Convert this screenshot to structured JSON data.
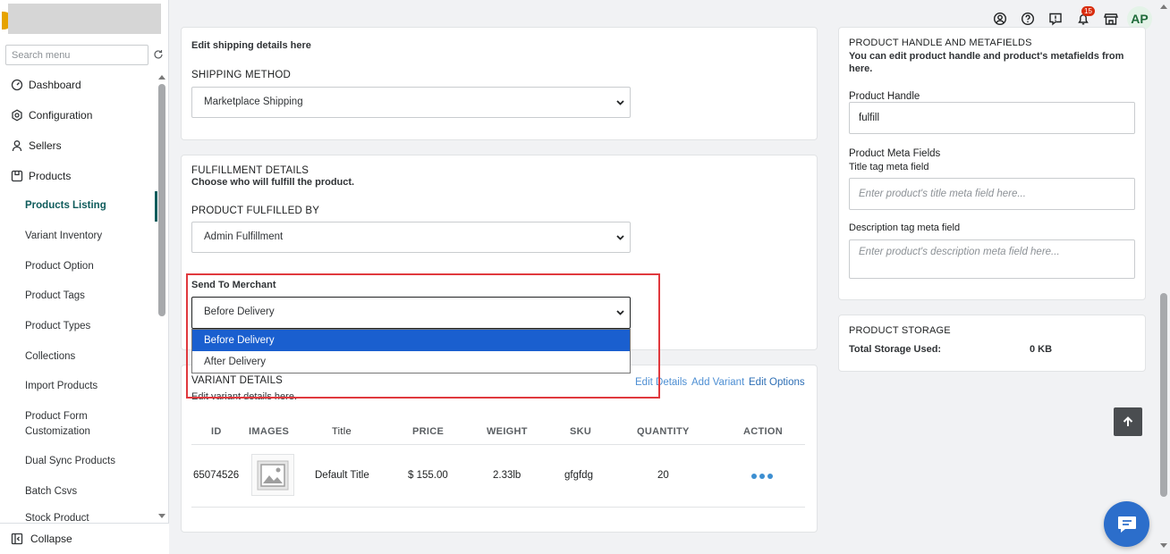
{
  "sidebar": {
    "search_placeholder": "Search menu",
    "top_items": [
      {
        "label": "Dashboard",
        "icon": "dashboard-icon"
      },
      {
        "label": "Configuration",
        "icon": "gear-icon"
      },
      {
        "label": "Sellers",
        "icon": "user-icon"
      },
      {
        "label": "Products",
        "icon": "product-icon"
      }
    ],
    "sub_items": [
      {
        "label": "Products Listing",
        "active": true
      },
      {
        "label": "Variant Inventory"
      },
      {
        "label": "Product Option"
      },
      {
        "label": "Product Tags"
      },
      {
        "label": "Product Types"
      },
      {
        "label": "Collections"
      },
      {
        "label": "Import Products"
      },
      {
        "label": "Product Form Customization"
      },
      {
        "label": "Dual Sync Products"
      },
      {
        "label": "Batch Csvs"
      },
      {
        "label": "Stock Product"
      }
    ],
    "collapse_label": "Collapse"
  },
  "topbar": {
    "notification_count": "15",
    "avatar_initials": "AP"
  },
  "shipping": {
    "subtitle": "Edit shipping details here",
    "method_label": "SHIPPING METHOD",
    "method_value": "Marketplace Shipping"
  },
  "fulfillment": {
    "title": "FULFILLMENT DETAILS",
    "subtitle": "Choose who will fulfill the product.",
    "by_label": "PRODUCT FULFILLED BY",
    "by_value": "Admin Fulfillment",
    "send_label": "Send To Merchant",
    "send_value": "Before Delivery",
    "send_options": [
      "Before Delivery",
      "After Delivery"
    ]
  },
  "variants": {
    "title": "VARIANT DETAILS",
    "subtitle": "Edit variant details here.",
    "edit_details": "Edit Details",
    "add_variant": "Add Variant",
    "edit_options": "Edit Options",
    "columns": [
      "ID",
      "IMAGES",
      "Title",
      "PRICE",
      "WEIGHT",
      "SKU",
      "QUANTITY",
      "ACTION"
    ],
    "row": {
      "id": "65074526",
      "title": "Default Title",
      "price": "$ 155.00",
      "weight": "2.33lb",
      "sku": "gfgfdg",
      "quantity": "20"
    }
  },
  "handle": {
    "title": "PRODUCT HANDLE AND METAFIELDS",
    "subtitle": "You can edit product handle and product's metafields from here.",
    "handle_label": "Product Handle",
    "handle_value": "fulfill",
    "meta_label": "Product Meta Fields",
    "title_tag_label": "Title tag meta field",
    "title_tag_placeholder": "Enter product's title meta field here...",
    "desc_tag_label": "Description tag meta field",
    "desc_tag_placeholder": "Enter product's description meta field here..."
  },
  "storage": {
    "title": "PRODUCT STORAGE",
    "used_label": "Total Storage Used:",
    "used_value": "0 KB"
  },
  "colors": {
    "accent": "#0f5c5c",
    "link": "#4e8fd3",
    "highlight": "#e0393e",
    "selected_option": "#1a5fcf"
  }
}
